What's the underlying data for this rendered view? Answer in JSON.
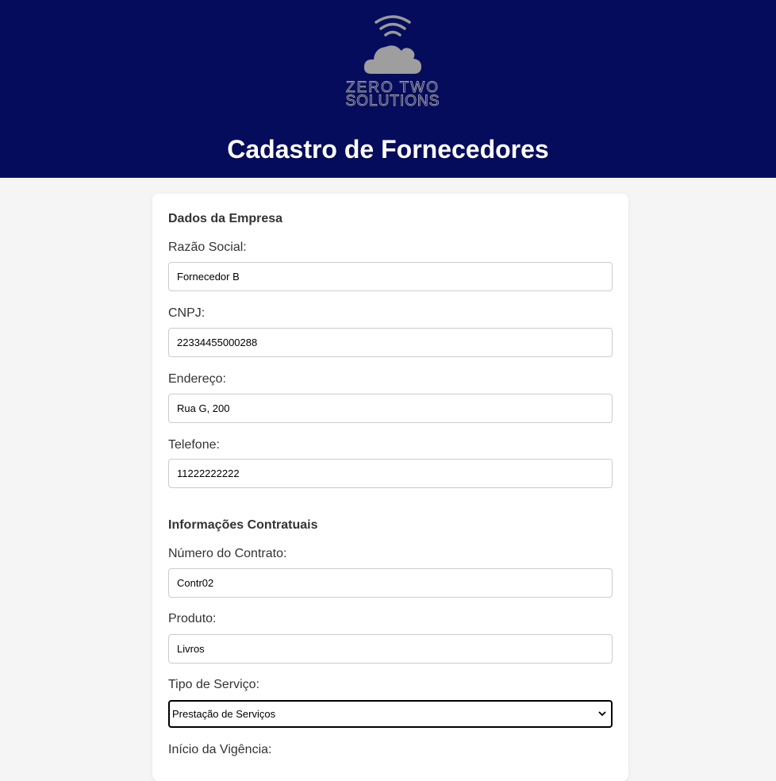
{
  "header": {
    "logo_text_line1": "ZERO TWO",
    "logo_text_line2": "SOLUTIONS",
    "title": "Cadastro de Fornecedores",
    "background": "#060c5c"
  },
  "company": {
    "section_title": "Dados da Empresa",
    "razao_social": {
      "label": "Razão Social:",
      "value": "Fornecedor B"
    },
    "cnpj": {
      "label": "CNPJ:",
      "value": "22334455000288"
    },
    "endereco": {
      "label": "Endereço:",
      "value": "Rua G, 200"
    },
    "telefone": {
      "label": "Telefone:",
      "value": "11222222222"
    }
  },
  "contract": {
    "section_title": "Informações Contratuais",
    "numero": {
      "label": "Número do Contrato:",
      "value": "Contr02"
    },
    "produto": {
      "label": "Produto:",
      "value": "Livros"
    },
    "tipo_servico": {
      "label": "Tipo de Serviço:",
      "selected": "Prestação de Serviços"
    },
    "inicio_vigencia": {
      "label": "Início da Vigência:"
    }
  },
  "icons": {
    "logo": "cloud-wifi-icon",
    "select_arrow": "chevron-down-icon"
  }
}
